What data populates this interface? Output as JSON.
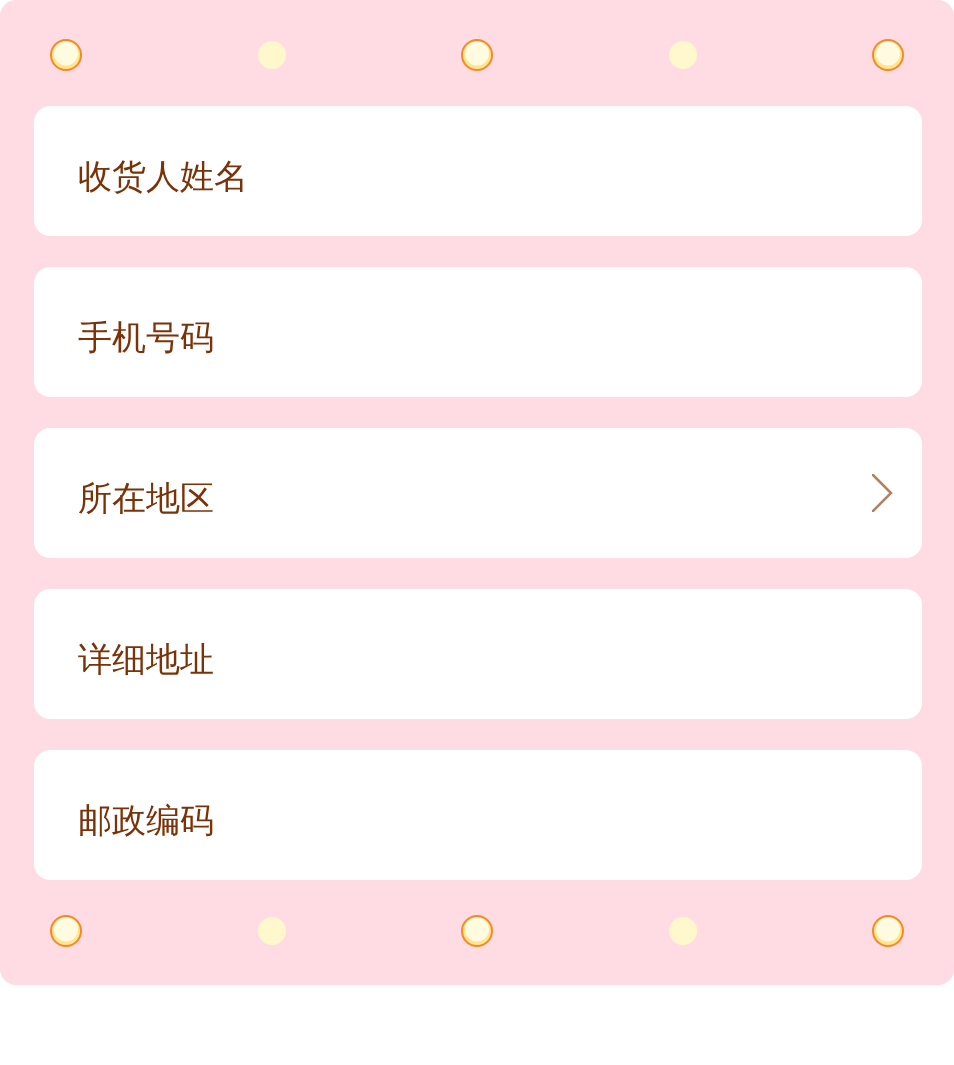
{
  "fields": [
    {
      "kind": "text",
      "placeholder": "收货人姓名"
    },
    {
      "kind": "text",
      "placeholder": "手机号码"
    },
    {
      "kind": "select",
      "placeholder": "所在地区"
    },
    {
      "kind": "text",
      "placeholder": "详细地址"
    },
    {
      "kind": "text",
      "placeholder": "邮政编码"
    }
  ]
}
